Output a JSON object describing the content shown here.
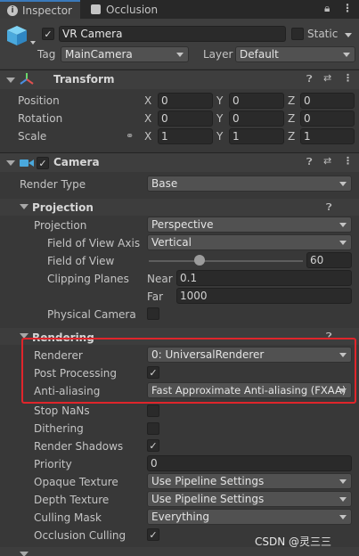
{
  "tabs": [
    {
      "label": "Inspector",
      "icon": "info-icon"
    },
    {
      "label": "Occlusion",
      "icon": "occlusion-icon"
    }
  ],
  "gameobject": {
    "name": "VR Camera",
    "static_label": "Static",
    "tag_label": "Tag",
    "tag_value": "MainCamera",
    "layer_label": "Layer",
    "layer_value": "Default"
  },
  "transform": {
    "title": "Transform",
    "rows": [
      {
        "label": "Position",
        "x": "0",
        "y": "0",
        "z": "0"
      },
      {
        "label": "Rotation",
        "x": "0",
        "y": "0",
        "z": "0"
      },
      {
        "label": "Scale",
        "x": "1",
        "y": "1",
        "z": "1"
      }
    ],
    "axis": {
      "x": "X",
      "y": "Y",
      "z": "Z"
    }
  },
  "camera": {
    "title": "Camera",
    "render_type_label": "Render Type",
    "render_type_value": "Base",
    "projection": {
      "title": "Projection",
      "projection_label": "Projection",
      "projection_value": "Perspective",
      "fov_axis_label": "Field of View Axis",
      "fov_axis_value": "Vertical",
      "fov_label": "Field of View",
      "fov_value": "60",
      "fov_fraction": 0.33,
      "clipping_label": "Clipping Planes",
      "near_label": "Near",
      "near_value": "0.1",
      "far_label": "Far",
      "far_value": "1000",
      "physical_label": "Physical Camera"
    },
    "rendering": {
      "title": "Rendering",
      "renderer_label": "Renderer",
      "renderer_value": "0: UniversalRenderer",
      "post_label": "Post Processing",
      "aa_label": "Anti-aliasing",
      "aa_value": "Fast Approximate Anti-aliasing (FXAA)",
      "stop_nans_label": "Stop NaNs",
      "dithering_label": "Dithering",
      "shadows_label": "Render Shadows",
      "priority_label": "Priority",
      "priority_value": "0",
      "opaque_label": "Opaque Texture",
      "opaque_value": "Use Pipeline Settings",
      "depth_label": "Depth Texture",
      "depth_value": "Use Pipeline Settings",
      "culling_label": "Culling Mask",
      "culling_value": "Everything",
      "occlusion_label": "Occlusion Culling"
    }
  },
  "watermark": "CSDN @灵三三",
  "colors": {
    "highlight_box": "#e0252b",
    "tab_accent": "#3a79bb"
  }
}
